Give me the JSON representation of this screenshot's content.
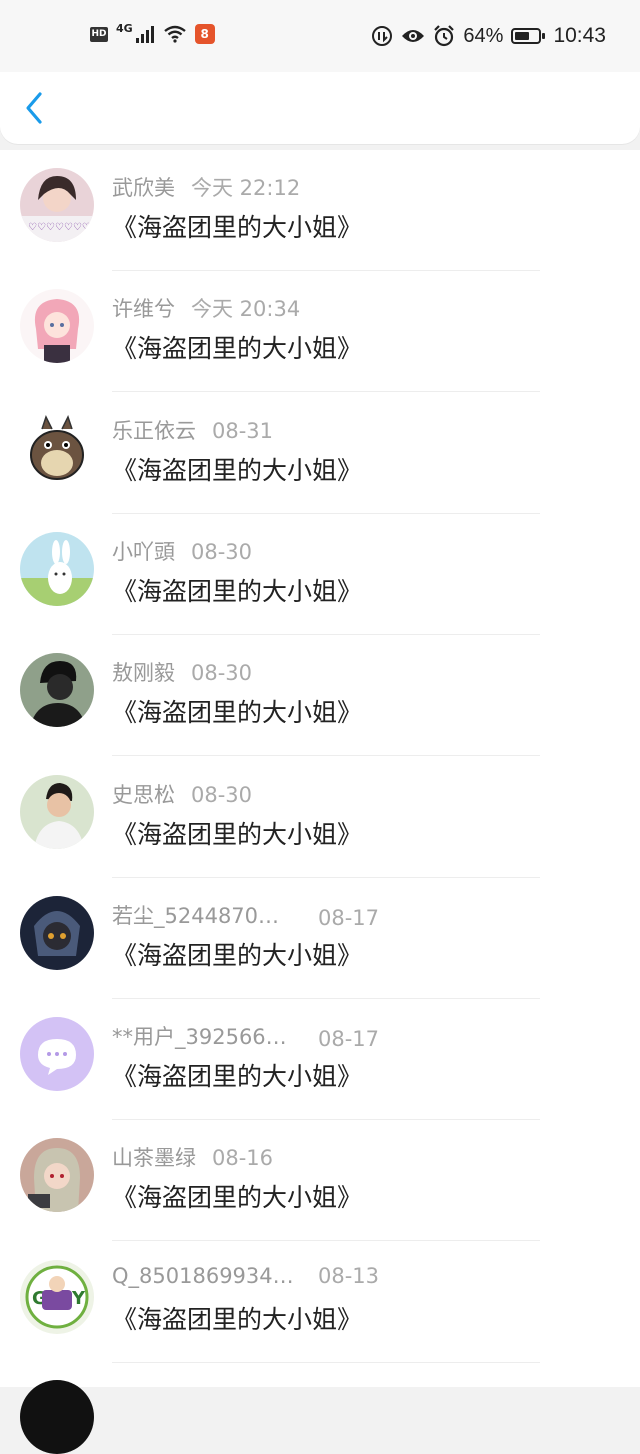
{
  "status_bar": {
    "hd": "HD",
    "network": "4G",
    "app_badge": "8",
    "battery_text": "64%",
    "battery_level": 0.64,
    "time": "10:43"
  },
  "colors": {
    "accent": "#1a9bea",
    "text_primary": "#222222",
    "text_secondary": "#999999"
  },
  "items": [
    {
      "name": "武欣美",
      "date": "今天 22:12",
      "title": "《海盗团里的大小姐》"
    },
    {
      "name": "许维兮",
      "date": "今天 20:34",
      "title": "《海盗团里的大小姐》"
    },
    {
      "name": "乐正依云",
      "date": "08-31",
      "title": "《海盗团里的大小姐》"
    },
    {
      "name": "小吖頭",
      "date": "08-30",
      "title": "《海盗团里的大小姐》"
    },
    {
      "name": "敖刚毅",
      "date": "08-30",
      "title": "《海盗团里的大小姐》"
    },
    {
      "name": "史思松",
      "date": "08-30",
      "title": "《海盗团里的大小姐》"
    },
    {
      "name": "若尘_5244870…",
      "date": "08-17",
      "title": "《海盗团里的大小姐》"
    },
    {
      "name": "**用户_392566…",
      "date": "08-17",
      "title": "《海盗团里的大小姐》"
    },
    {
      "name": "山茶墨绿",
      "date": "08-16",
      "title": "《海盗团里的大小姐》"
    },
    {
      "name": "Q_8501869934…",
      "date": "08-13",
      "title": "《海盗团里的大小姐》"
    }
  ]
}
